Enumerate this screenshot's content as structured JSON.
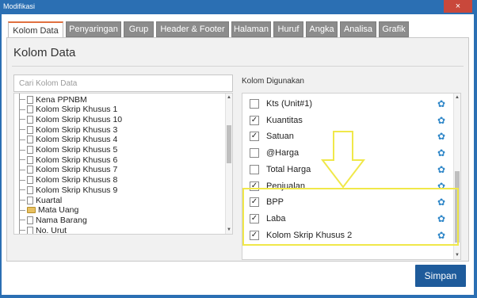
{
  "window": {
    "title": "Modifikasi",
    "close_label": "×"
  },
  "tabs": [
    {
      "label": "Kolom Data",
      "active": true
    },
    {
      "label": "Penyaringan"
    },
    {
      "label": "Grup"
    },
    {
      "label": "Header & Footer"
    },
    {
      "label": "Halaman"
    },
    {
      "label": "Huruf"
    },
    {
      "label": "Angka"
    },
    {
      "label": "Analisa"
    },
    {
      "label": "Grafik"
    }
  ],
  "panel": {
    "title": "Kolom Data",
    "search_placeholder": "Cari Kolom Data",
    "used_label": "Kolom Digunakan"
  },
  "tree_items": [
    {
      "label": "Kena PPNBM",
      "icon": "doc-icon"
    },
    {
      "label": "Kolom Skrip Khusus 1",
      "icon": "doc-icon"
    },
    {
      "label": "Kolom Skrip Khusus 10",
      "icon": "doc-icon"
    },
    {
      "label": "Kolom Skrip Khusus 3",
      "icon": "doc-icon"
    },
    {
      "label": "Kolom Skrip Khusus 4",
      "icon": "doc-icon"
    },
    {
      "label": "Kolom Skrip Khusus 5",
      "icon": "doc-icon"
    },
    {
      "label": "Kolom Skrip Khusus 6",
      "icon": "doc-icon"
    },
    {
      "label": "Kolom Skrip Khusus 7",
      "icon": "doc-icon"
    },
    {
      "label": "Kolom Skrip Khusus 8",
      "icon": "doc-icon"
    },
    {
      "label": "Kolom Skrip Khusus 9",
      "icon": "doc-icon"
    },
    {
      "label": "Kuartal",
      "icon": "doc-icon"
    },
    {
      "label": "Mata Uang",
      "icon": "folder-icon"
    },
    {
      "label": "Nama Barang",
      "icon": "doc-icon"
    },
    {
      "label": "No. Urut",
      "icon": "doc-icon"
    }
  ],
  "used_columns": [
    {
      "label": "Kts (Unit#1)",
      "checked": false
    },
    {
      "label": "Kuantitas",
      "checked": true
    },
    {
      "label": "Satuan",
      "checked": true
    },
    {
      "label": "@Harga",
      "checked": false
    },
    {
      "label": "Total Harga",
      "checked": false
    },
    {
      "label": "Penjualan",
      "checked": true
    },
    {
      "label": "BPP",
      "checked": true
    },
    {
      "label": "Laba",
      "checked": true
    },
    {
      "label": "Kolom Skrip Khusus 2",
      "checked": true
    }
  ],
  "save_label": "Simpan",
  "colors": {
    "frame": "#2b6fb3",
    "save_button": "#1e5b9b",
    "gear": "#2e86c8",
    "highlight": "#f0e84a"
  }
}
